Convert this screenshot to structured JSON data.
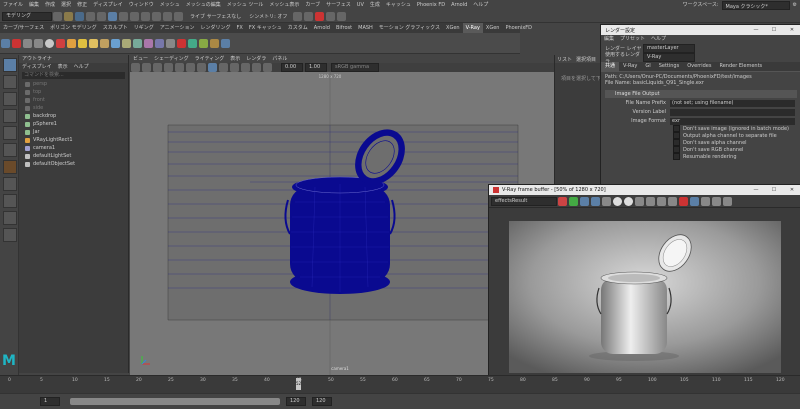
{
  "menubar": {
    "items": [
      "ファイル",
      "編集",
      "作成",
      "選択",
      "修正",
      "ディスプレイ",
      "ウィンドウ",
      "メッシュ",
      "メッシュの編集",
      "メッシュ ツール",
      "メッシュ表示",
      "カーブ",
      "サーフェス",
      "UV",
      "生成",
      "キャッシュ",
      "Phoenix FD",
      "Arnold",
      "ヘルプ"
    ],
    "workspace_label": "ワークスペース:",
    "workspace_value": "Maya クラシック*"
  },
  "statusline": {
    "mode": "モデリング",
    "symmetry": "シンメトリ: オフ",
    "no_live": "ライブ サーフェスなし"
  },
  "shelf_tabs": {
    "items": [
      "カーブ/サーフェス",
      "ポリゴン モデリング",
      "スカルプト",
      "リギング",
      "アニメーション",
      "レンダリング",
      "FX",
      "FX キャッシュ",
      "カスタム",
      "Arnold",
      "Bifrost",
      "MASH",
      "モーション グラフィックス",
      "XGen",
      "V-Ray",
      "XGen",
      "PhoenixFD"
    ],
    "active_index": 14
  },
  "outliner": {
    "title": "アウトライナ",
    "menu": [
      "ディスプレイ",
      "表示",
      "ヘルプ"
    ],
    "search_placeholder": "コマンドを検索...",
    "items": [
      {
        "label": "persp",
        "dim": true,
        "color": "#6b6b6b"
      },
      {
        "label": "top",
        "dim": true,
        "color": "#6b6b6b"
      },
      {
        "label": "front",
        "dim": true,
        "color": "#6b6b6b"
      },
      {
        "label": "side",
        "dim": true,
        "color": "#6b6b6b"
      },
      {
        "label": "backdrop",
        "dim": false,
        "color": "#8fbf8f"
      },
      {
        "label": "pSphere1",
        "dim": false,
        "color": "#8fbf8f"
      },
      {
        "label": "Jar",
        "dim": false,
        "color": "#8fbf8f"
      },
      {
        "label": "VRayLightRect1",
        "dim": false,
        "color": "#e0a040"
      },
      {
        "label": "camera1",
        "dim": false,
        "color": "#a0a0d0"
      },
      {
        "label": "defaultLightSet",
        "dim": false,
        "color": "#c0c0c0"
      },
      {
        "label": "defaultObjectSet",
        "dim": false,
        "color": "#c0c0c0"
      }
    ]
  },
  "viewport": {
    "menu": [
      "ビュー",
      "シェーディング",
      "ライティング",
      "表示",
      "レンダラ",
      "パネル"
    ],
    "resolution_label": "1280 x 720",
    "camera_label": "camera1",
    "time_value": "0.00",
    "scale_value": "1.00",
    "colorspace": "sRGB gamma"
  },
  "render_settings": {
    "title": "レンダー設定",
    "menu": [
      "編集",
      "プリセット",
      "ヘルプ"
    ],
    "render_layer_label": "レンダー レイヤ",
    "render_layer_value": "masterLayer",
    "renderer_label": "使用するレンダラ",
    "renderer_value": "V-Ray",
    "tabs": [
      "共通",
      "V-Ray",
      "GI",
      "Settings",
      "Overrides",
      "Render Elements"
    ],
    "active_tab": 0,
    "path_label": "Path: C:/Users/Onur-PC/Documents/PhoenixFD/test/images",
    "file_label": "File Name: basicLiquids_Q91_Single.exr",
    "section": "Image File Output",
    "fields": [
      {
        "label": "File Name Prefix",
        "value": "(not set; using filename)"
      },
      {
        "label": "Version Label",
        "value": ""
      },
      {
        "label": "Image Format",
        "value": "exr"
      }
    ],
    "checkboxes": [
      "Don't save image (ignored in batch mode)",
      "Output alpha channel to separate file",
      "Don't save alpha channel",
      "Don't save RGB channel",
      "Resumable rendering"
    ]
  },
  "right_panel": {
    "tabs": [
      "リスト",
      "選択項目"
    ],
    "button": "項目を選択して下"
  },
  "frame_buffer": {
    "title": "V-Ray frame buffer - [50% of 1280 x 720]",
    "channel": "effectsResult"
  },
  "timeline": {
    "ticks": [
      "0",
      "5",
      "10",
      "15",
      "20",
      "25",
      "30",
      "35",
      "40",
      "45",
      "50",
      "55",
      "60",
      "65",
      "70",
      "75",
      "80",
      "85",
      "90",
      "95",
      "100",
      "105",
      "110",
      "115",
      "120"
    ],
    "current_frame": "52",
    "range_start": "1",
    "range_end": "120",
    "playback_end": "120"
  },
  "colors": {
    "accent": "#5b7fa6",
    "wire": "#0a0a90",
    "maya_logo": "#1fb5c4"
  }
}
